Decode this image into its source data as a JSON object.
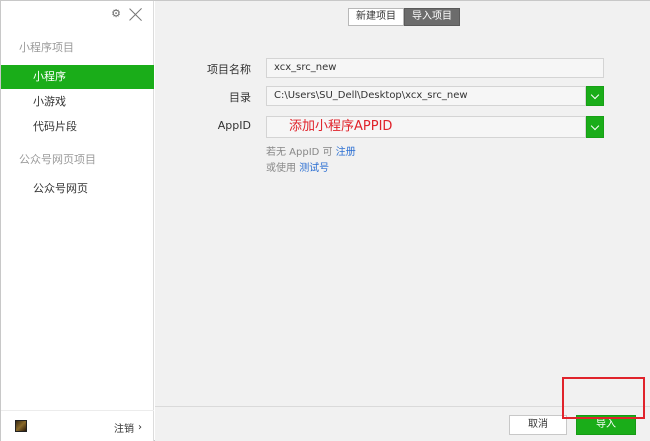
{
  "sidebar": {
    "sections": [
      {
        "title": "小程序项目"
      },
      {
        "title": "公众号网页项目"
      }
    ],
    "items": [
      {
        "label": "小程序"
      },
      {
        "label": "小游戏"
      },
      {
        "label": "代码片段"
      },
      {
        "label": "公众号网页"
      }
    ],
    "footer": {
      "logout_label": "注销",
      "chevron": "›"
    },
    "controls": {
      "gear": "⚙"
    }
  },
  "tabs": [
    {
      "label": "新建项目"
    },
    {
      "label": "导入项目"
    }
  ],
  "form": {
    "name_label": "项目名称",
    "name_value": "xcx_src_new",
    "dir_label": "目录",
    "dir_value": "C:\\Users\\SU_Dell\\Desktop\\xcx_src_new",
    "appid_label": "AppID",
    "appid_value": "添加小程序APPID",
    "hint1_prefix": "若无 AppID 可 ",
    "hint1_link": "注册",
    "hint2_prefix": "或使用 ",
    "hint2_link": "测试号"
  },
  "buttons": {
    "cancel": "取消",
    "import": "导入"
  },
  "colors": {
    "accent": "#1aad19",
    "highlight": "#e0232b",
    "link": "#2a6ed2"
  }
}
